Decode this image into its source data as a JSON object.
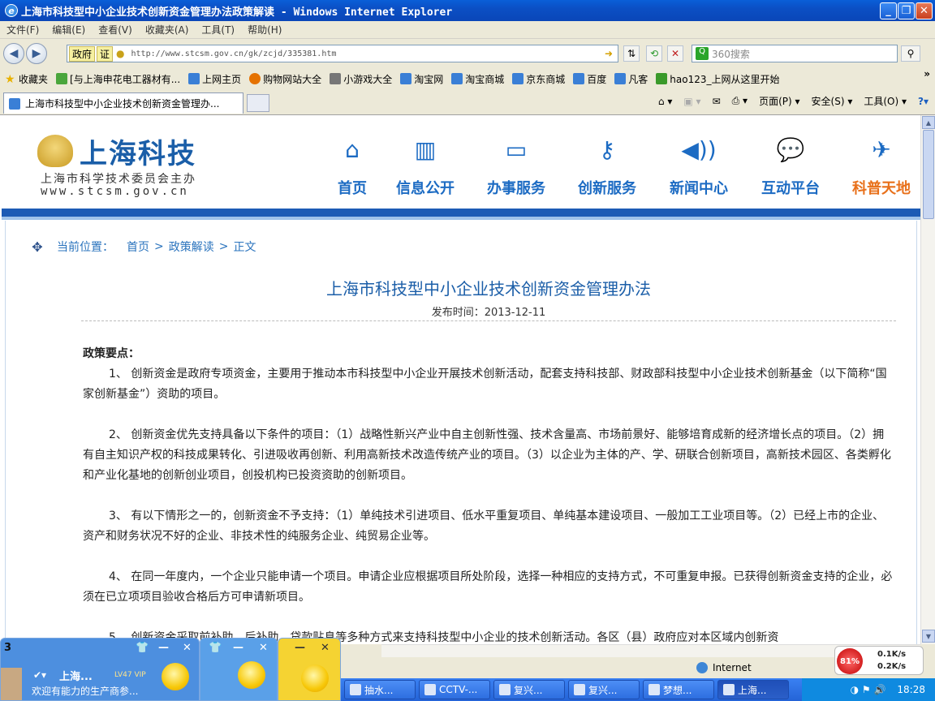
{
  "window": {
    "title": "上海市科技型中小企业技术创新资金管理办法政策解读 - Windows Internet Explorer"
  },
  "menu": [
    "文件(F)",
    "编辑(E)",
    "查看(V)",
    "收藏夹(A)",
    "工具(T)",
    "帮助(H)"
  ],
  "address": {
    "tag": "政府",
    "tag2": "证",
    "url": "http://www.stcsm.gov.cn/gk/zcjd/335381.htm"
  },
  "search": {
    "placeholder": "360搜索"
  },
  "favorites": {
    "label": "收藏夹",
    "items": [
      "[与上海申花电工器材有...",
      "上网主页",
      "购物网站大全",
      "小游戏大全",
      "淘宝网",
      "淘宝商城",
      "京东商城",
      "百度",
      "凡客",
      "hao123_上网从这里开始"
    ]
  },
  "tabs": {
    "active": "上海市科技型中小企业技术创新资金管理办..."
  },
  "commandbar": {
    "page": "页面(P)",
    "safety": "安全(S)",
    "tools": "工具(O)"
  },
  "site": {
    "logo_title": "上海科技",
    "logo_sub": "上海市科学技术委员会主办",
    "logo_url": "www.stcsm.gov.cn",
    "nav": [
      {
        "label": "首页",
        "icon": "home-icon",
        "color": "#1c6bc3"
      },
      {
        "label": "信息公开",
        "icon": "binders-icon",
        "color": "#1c6bc3"
      },
      {
        "label": "办事服务",
        "icon": "monitor-icon",
        "color": "#1c6bc3"
      },
      {
        "label": "创新服务",
        "icon": "key-icon",
        "color": "#1c6bc3"
      },
      {
        "label": "新闻中心",
        "icon": "speaker-icon",
        "color": "#1c6bc3"
      },
      {
        "label": "互动平台",
        "icon": "chat-icon",
        "color": "#1c6bc3"
      },
      {
        "label": "科普天地",
        "icon": "satellite-icon",
        "color": "#e8701a"
      }
    ]
  },
  "breadcrumb": {
    "prefix": "当前位置：",
    "items": [
      "首页",
      ">",
      "政策解读",
      ">",
      "正文"
    ]
  },
  "article": {
    "title": "上海市科技型中小企业技术创新资金管理办法",
    "date": "发布时间：2013-12-11",
    "heading": "政策要点：",
    "paragraphs": [
      "1、 创新资金是政府专项资金，主要用于推动本市科技型中小企业开展技术创新活动，配套支持科技部、财政部科技型中小企业技术创新基金（以下简称“国家创新基金”）资助的项目。",
      "2、 创新资金优先支持具备以下条件的项目：（1）战略性新兴产业中自主创新性强、技术含量高、市场前景好、能够培育成新的经济增长点的项目。（2）拥有自主知识产权的科技成果转化、引进吸收再创新、利用高新技术改造传统产业的项目。（3）以企业为主体的产、学、研联合创新项目，高新技术园区、各类孵化和产业化基地的创新创业项目，创投机构已投资资助的创新项目。",
      "3、 有以下情形之一的，创新资金不予支持：（1）单纯技术引进项目、低水平重复项目、单纯基本建设项目、一般加工工业项目等。（2）已经上市的企业、资产和财务状况不好的企业、非技术性的纯服务企业、纯贸易企业等。",
      "4、 在同一年度内，一个企业只能申请一个项目。申请企业应根据项目所处阶段，选择一种相应的支持方式，不可重复申报。已获得创新资金支持的企业，必须在已立项项目验收合格后方可申请新项目。",
      "5、 创新资金采取前补助、后补助、贷款贴息等多种方式来支持科技型中小企业的技术创新活动。各区（县）政府应对本区域内创新资"
    ]
  },
  "status": {
    "zone": "Internet"
  },
  "network": {
    "percent": "81%",
    "up": "0.1K/s",
    "down": "0.2K/s"
  },
  "popup": {
    "name": "上海...",
    "message": "欢迎有能力的生产商参...",
    "number": "3",
    "vip": "LV47 VIP",
    "num2": "3"
  },
  "taskbar": {
    "tasks": [
      "抽水...",
      "CCTV-...",
      "复兴...",
      "复兴...",
      "梦想...",
      "上海..."
    ],
    "clock": "18:28"
  }
}
